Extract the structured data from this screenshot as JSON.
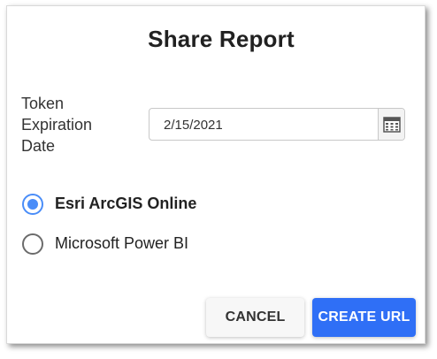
{
  "dialog": {
    "title": "Share Report"
  },
  "token": {
    "label": "Token Expiration Date",
    "date_value": "2/15/2021"
  },
  "options": [
    {
      "label": "Esri ArcGIS Online",
      "selected": true
    },
    {
      "label": "Microsoft Power BI",
      "selected": false
    }
  ],
  "buttons": {
    "cancel_label": "CANCEL",
    "create_label": "CREATE URL"
  },
  "colors": {
    "primary": "#2f6ff6",
    "radio_selected": "#4a8df8"
  },
  "icons": {
    "calendar": "calendar-icon"
  }
}
